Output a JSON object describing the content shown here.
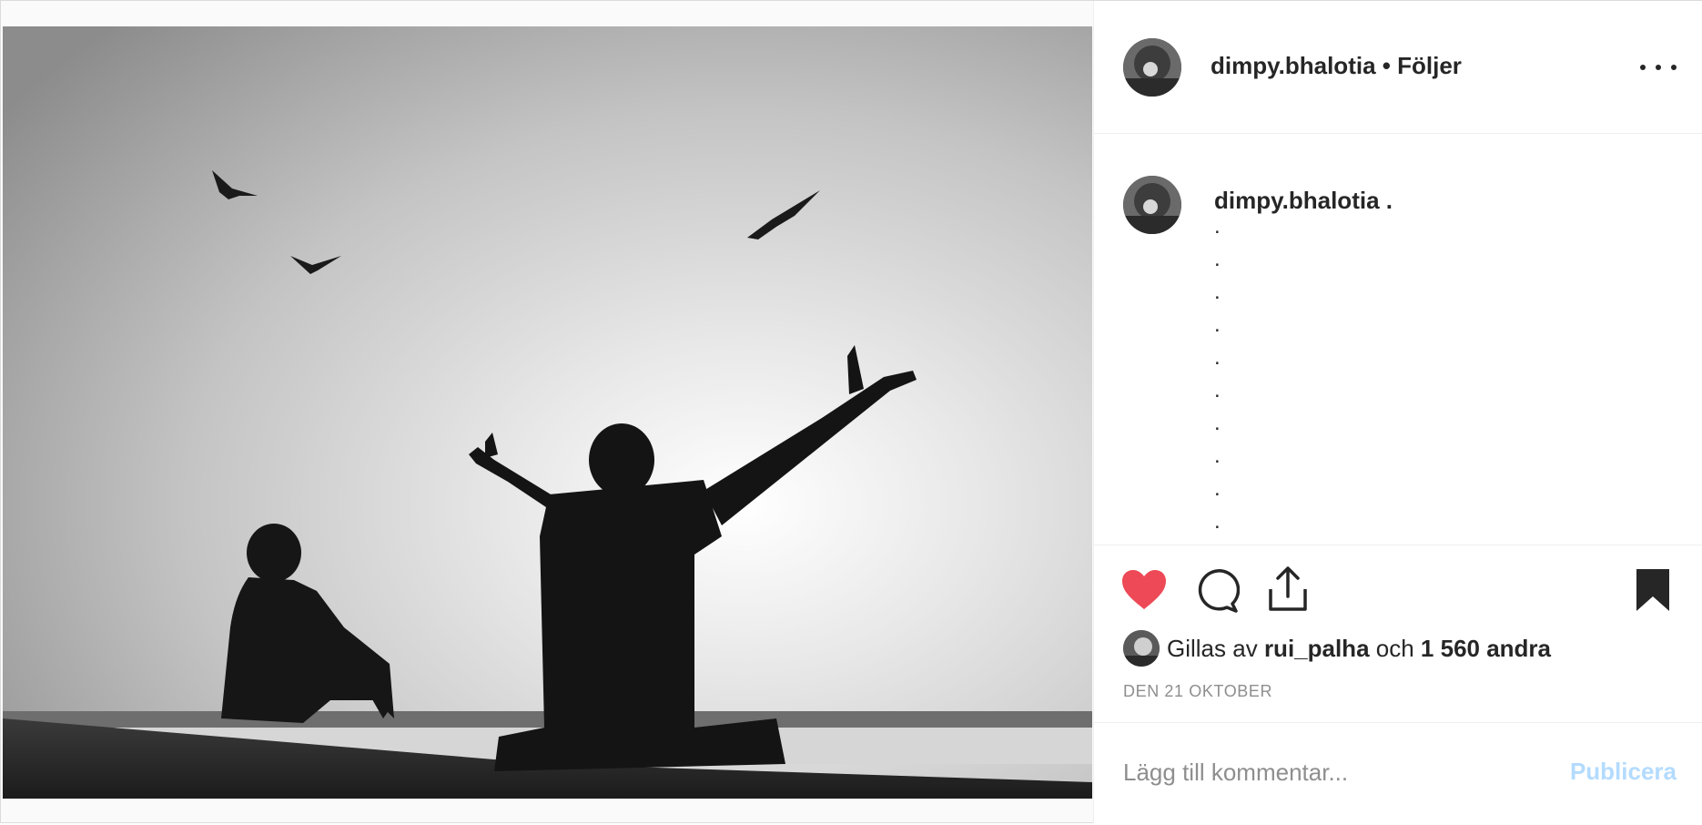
{
  "post": {
    "username": "dimpy.bhalotia",
    "separator": "•",
    "follow_label": "Följer",
    "more_icon": "more-horizontal-icon"
  },
  "caption": {
    "username": "dimpy.bhalotia",
    "text": ".",
    "dot_lines": [
      ".",
      ".",
      ".",
      ".",
      ".",
      ".",
      ".",
      ".",
      ".",
      "."
    ]
  },
  "actions": {
    "like_icon": "heart-filled-icon",
    "like_color": "#ed4956",
    "comment_icon": "comment-bubble-icon",
    "share_icon": "share-upload-icon",
    "save_icon": "bookmark-filled-icon"
  },
  "likes": {
    "prefix": "Gillas av",
    "user": "rui_palha",
    "conjunction": "och",
    "others": "1 560 andra"
  },
  "date": "DEN 21 OKTOBER",
  "comment_box": {
    "placeholder": "Lägg till kommentar...",
    "publish_label": "Publicera",
    "publish_color": "#b3dbff"
  }
}
